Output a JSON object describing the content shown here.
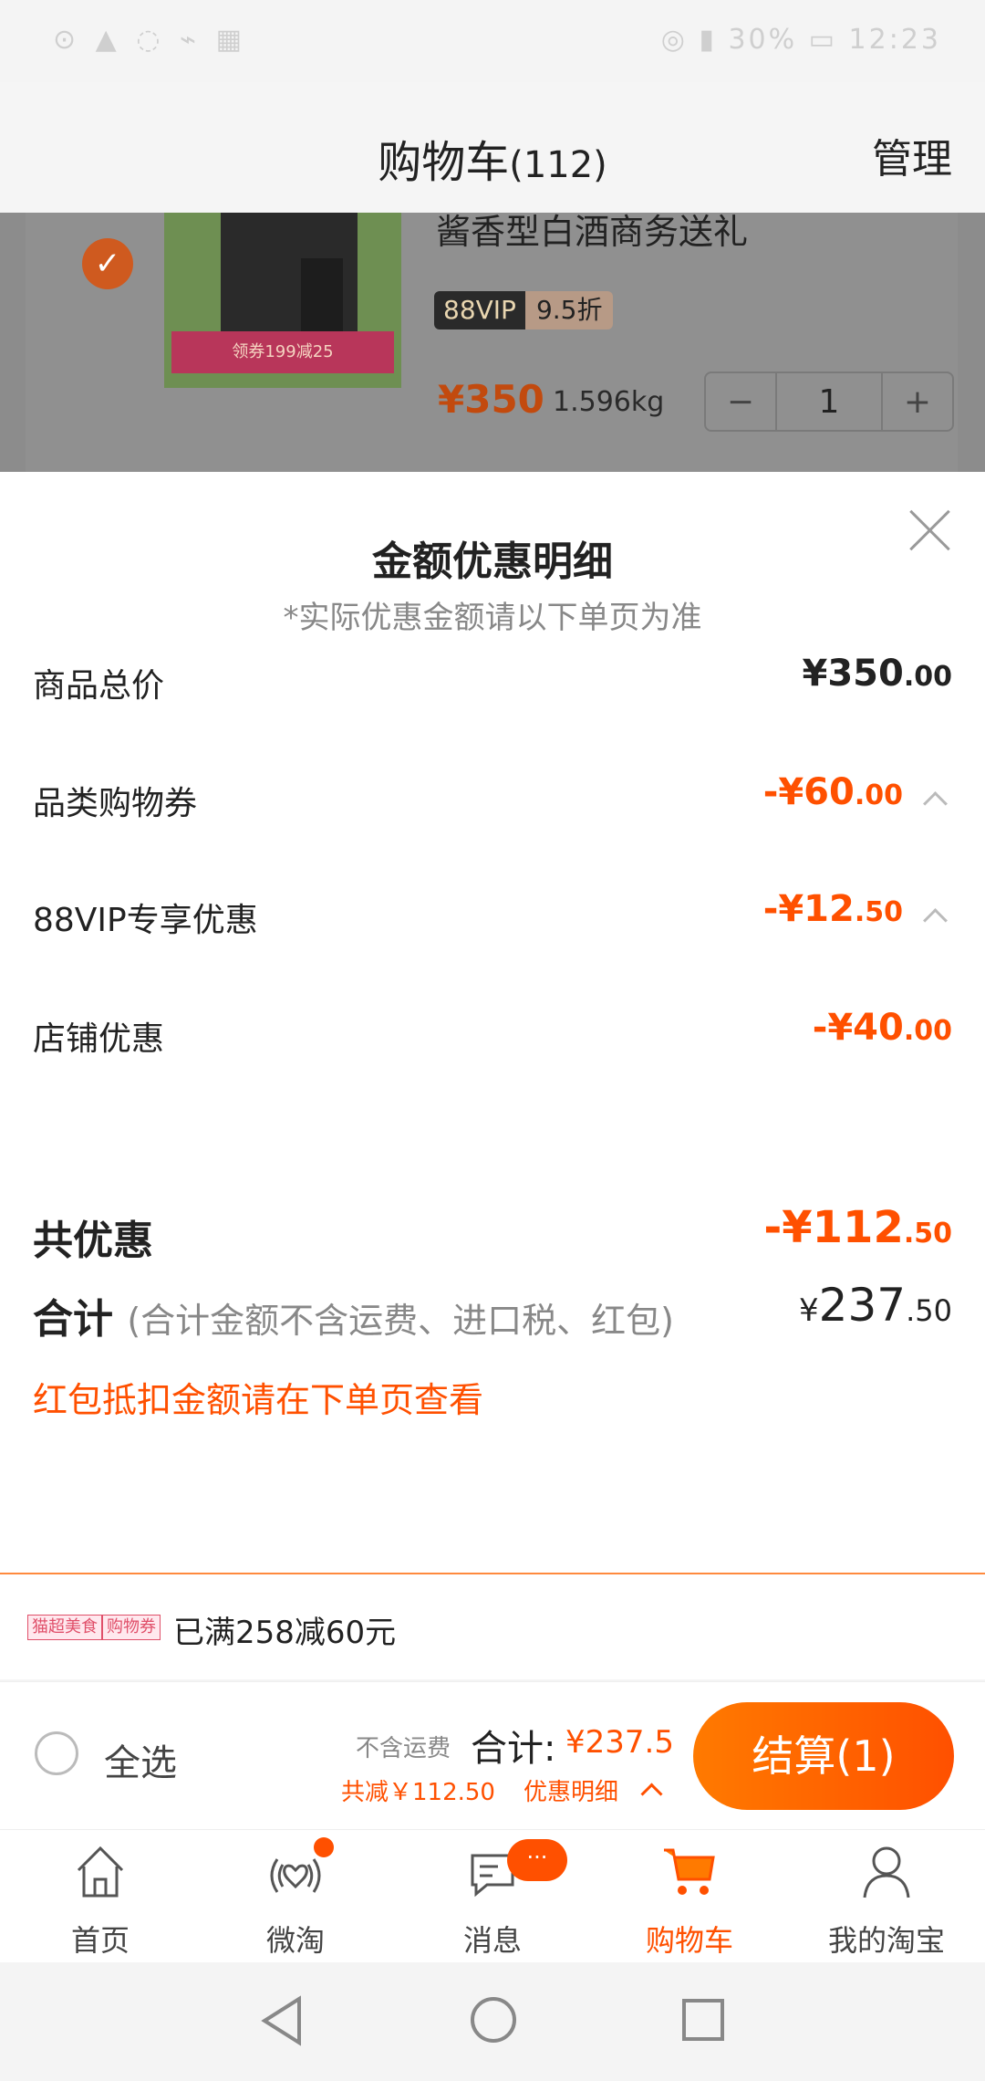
{
  "status_bar": {
    "left": "⊙ ▲ ◌ ⌁ ▦",
    "right": "◎ ▮ 30% ▭ 12:23"
  },
  "header": {
    "title": "购物车",
    "count": "(112)",
    "manage": "管理"
  },
  "product": {
    "title": "酱香型白酒商务送礼",
    "vip_tag": "88VIP",
    "discount_tag": "9.5折",
    "banner_text": "领券199减25",
    "price": "¥350",
    "weight": "1.596kg",
    "quantity": "1",
    "minus": "−",
    "plus": "+"
  },
  "sheet": {
    "title": "金额优惠明细",
    "note": "*实际优惠金额请以下单页为准",
    "rows": [
      {
        "label": "商品总价",
        "int": "¥350",
        "dec": ".00",
        "color": "#222222"
      },
      {
        "label": "品类购物券",
        "int": "-¥60",
        "dec": ".00",
        "color": "#ff5000"
      },
      {
        "label": "88VIP专享优惠",
        "int": "-¥12",
        "dec": ".50",
        "color": "#ff5000"
      },
      {
        "label": "店铺优惠",
        "int": "-¥40",
        "dec": ".00",
        "color": "#ff5000"
      }
    ],
    "total_discount": {
      "label": "共优惠",
      "int": "-¥112",
      "dec": ".50"
    },
    "sum": {
      "label": "合计",
      "note": "(合计金额不含运费、进口税、红包)",
      "currency": "¥",
      "int": "237",
      "dec": ".50"
    },
    "hint": "红包抵扣金额请在下单页查看"
  },
  "promo": {
    "tag1": "猫超美食",
    "tag2": "购物券",
    "text": "已满258减60元"
  },
  "checkout": {
    "select_all": "全选",
    "no_fee": "不含运费",
    "sum_label": "合计:",
    "sum_value": "¥237.5",
    "reduce": "共减￥112.50",
    "detail": "优惠明细",
    "button": "结算(1)"
  },
  "tabs": [
    {
      "label": "首页",
      "icon": "home-icon"
    },
    {
      "label": "微淘",
      "icon": "weitao-icon"
    },
    {
      "label": "消息",
      "icon": "message-icon",
      "badge": "···"
    },
    {
      "label": "购物车",
      "icon": "cart-icon",
      "active": true
    },
    {
      "label": "我的淘宝",
      "icon": "user-icon"
    }
  ],
  "colors": {
    "accent": "#ff5000",
    "accent_light": "#ff7a00"
  }
}
